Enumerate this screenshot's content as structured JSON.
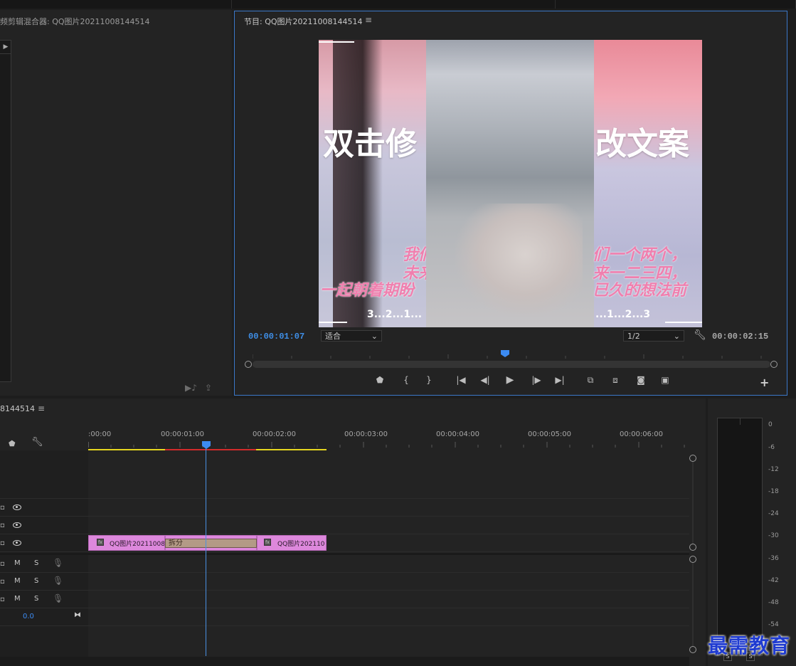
{
  "mixer": {
    "title": "频剪辑混合器: QQ图片20211008144514",
    "strip_arrow": "▶"
  },
  "program_monitor": {
    "title": "节目: QQ图片20211008144514",
    "menu_icon": "≡",
    "current_timecode": "00:00:01:07",
    "duration_timecode": "00:00:02:15",
    "fit_label": "适合",
    "resolution_label": "1/2"
  },
  "video_frame": {
    "left_big": "双击修",
    "right_big": "改文案",
    "pink_left_1": "我们",
    "pink_left_2": "未来",
    "pink_left_3": "一起朝着期盼",
    "pink_right_1": "们一个两个，",
    "pink_right_2": "来一二三四，",
    "pink_right_3": "已久的想法前",
    "count_left": "3...2...1...",
    "count_right": "...1...2...3"
  },
  "timeline": {
    "title": "8144514",
    "menu_icon": "≡",
    "ruler_labels": [
      ":00:00",
      "00:00:01:00",
      "00:00:02:00",
      "00:00:03:00",
      "00:00:04:00",
      "00:00:05:00",
      "00:00:06:00"
    ],
    "clip_left_label": "QQ图片20211008",
    "clip_right_label": "QQ图片202110",
    "split_label": "拆分",
    "fx_label": "fx",
    "master_value": "0.0",
    "audio_m": "M",
    "audio_s": "S"
  },
  "meter": {
    "db_labels": [
      "0",
      "-6",
      "-12",
      "-18",
      "-24",
      "-30",
      "-36",
      "-42",
      "-48",
      "-54"
    ],
    "solo": "S"
  },
  "watermark": {
    "text": "最需教育"
  },
  "colors": {
    "accent_blue": "#3c8bf2",
    "clip_pink": "#dd88dc",
    "work_yellow": "#e6d61f",
    "work_red": "#d12b2b",
    "watermark_blue": "#1f3bd1"
  }
}
